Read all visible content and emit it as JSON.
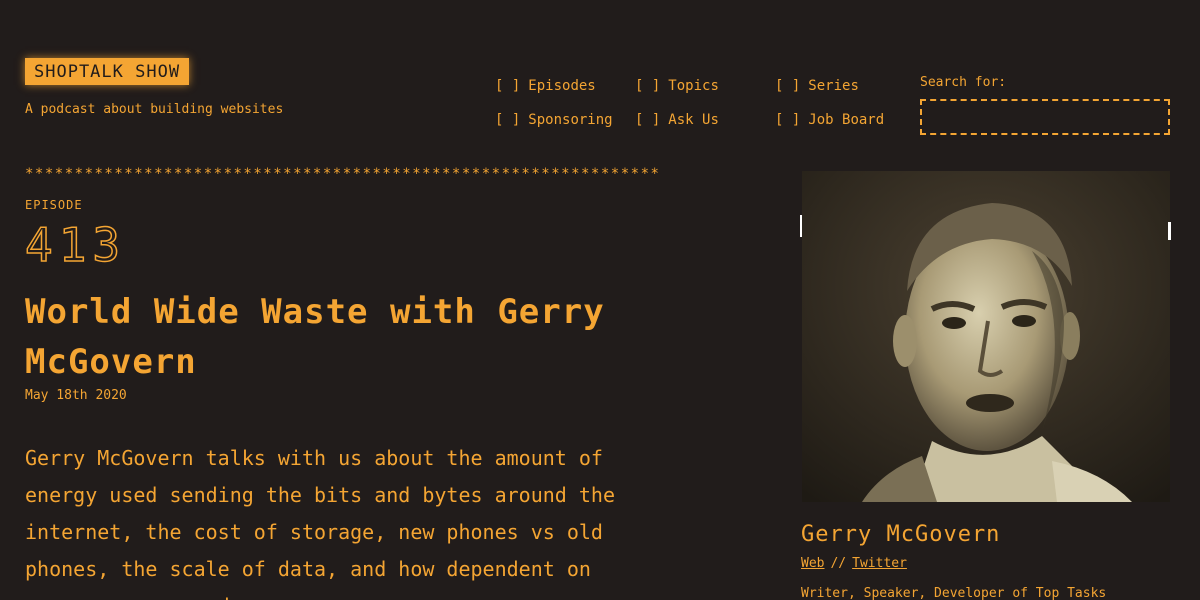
{
  "header": {
    "logo": "SHOPTALK SHOW",
    "tagline": "A podcast about building websites"
  },
  "nav": {
    "bracket": "[ ]",
    "items": [
      {
        "label": "Episodes"
      },
      {
        "label": "Topics"
      },
      {
        "label": "Series"
      },
      {
        "label": "Sponsoring"
      },
      {
        "label": "Ask Us"
      },
      {
        "label": "Job Board"
      }
    ]
  },
  "search": {
    "label": "Search for:",
    "value": "",
    "placeholder": ""
  },
  "episode": {
    "divider": "****************************************************************",
    "label": "EPISODE",
    "number": "413",
    "title": "World Wide Waste with Gerry McGovern",
    "date": "May 18th 2020",
    "description": "Gerry McGovern talks with us about the amount of energy used sending the bits and bytes around the internet, the cost of storage, new phones vs old phones, the scale of data, and how dependent on energy we are and"
  },
  "guest": {
    "name": "Gerry McGovern",
    "links": [
      {
        "label": "Web"
      },
      {
        "label": "Twitter"
      }
    ],
    "separator": "//",
    "bio": "Writer, Speaker, Developer of Top Tasks"
  },
  "colors": {
    "background": "#211c1b",
    "accent": "#f4a533"
  }
}
